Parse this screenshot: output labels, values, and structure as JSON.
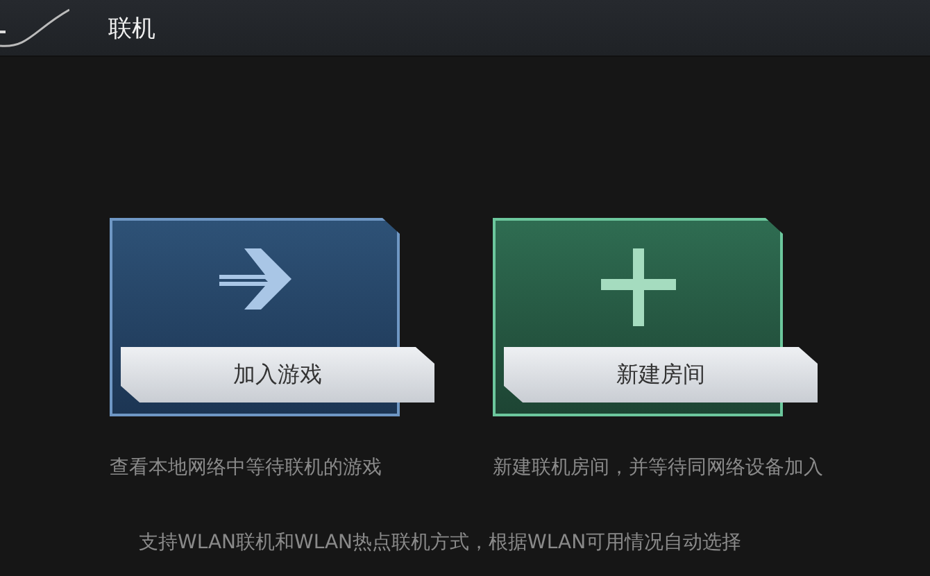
{
  "header": {
    "title": "联机"
  },
  "options": [
    {
      "kind": "join",
      "label": "加入游戏",
      "description": "查看本地网络中等待联机的游戏"
    },
    {
      "kind": "create",
      "label": "新建房间",
      "description": "新建联机房间，并等待同网络设备加入"
    }
  ],
  "footer": "支持WLAN联机和WLAN热点联机方式，根据WLAN可用情况自动选择"
}
